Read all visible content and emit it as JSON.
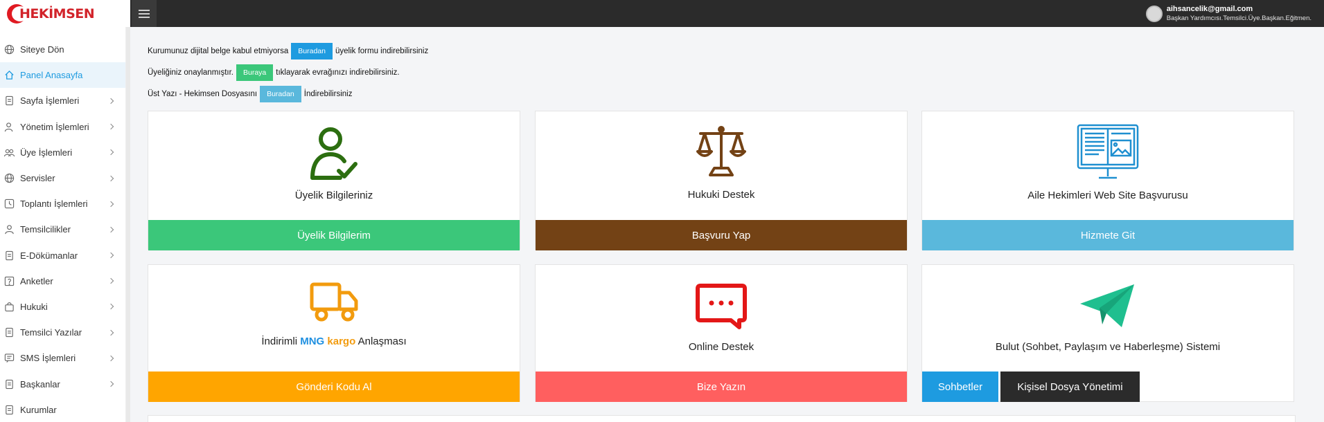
{
  "header": {
    "logo_text": "HEKİMSEN",
    "user_email": "aihsancelik@gmail.com",
    "user_role": "Başkan Yardımcısı.Temsilci.Üye.Başkan.Eğitmen."
  },
  "sidebar": {
    "items": [
      {
        "label": "Siteye Dön",
        "icon": "globe-icon",
        "chevron": false
      },
      {
        "label": "Panel Anasayfa",
        "icon": "home-icon",
        "chevron": false,
        "active": true
      },
      {
        "label": "Sayfa İşlemleri",
        "icon": "document-icon",
        "chevron": true
      },
      {
        "label": "Yönetim İşlemleri",
        "icon": "user-gear-icon",
        "chevron": true
      },
      {
        "label": "Üye İşlemleri",
        "icon": "users-icon",
        "chevron": true
      },
      {
        "label": "Servisler",
        "icon": "globe-icon",
        "chevron": true
      },
      {
        "label": "Toplantı İşlemleri",
        "icon": "clock-icon",
        "chevron": true
      },
      {
        "label": "Temsilcilikler",
        "icon": "user-icon",
        "chevron": true
      },
      {
        "label": "E-Dökümanlar",
        "icon": "document-icon",
        "chevron": true
      },
      {
        "label": "Anketler",
        "icon": "question-icon",
        "chevron": true
      },
      {
        "label": "Hukuki",
        "icon": "bag-icon",
        "chevron": true
      },
      {
        "label": "Temsilci Yazılar",
        "icon": "document-icon",
        "chevron": true
      },
      {
        "label": "SMS İşlemleri",
        "icon": "message-icon",
        "chevron": true
      },
      {
        "label": "Başkanlar",
        "icon": "document-icon",
        "chevron": true
      },
      {
        "label": "Kurumlar",
        "icon": "document-icon",
        "chevron": false
      }
    ]
  },
  "notices": [
    {
      "before": "Kurumunuz dijital belge kabul etmiyorsa",
      "button": "Buradan",
      "after": "üyelik formu indirebilirsiniz",
      "color": "#1e9be0"
    },
    {
      "before": "Üyeliğiniz onaylanmıştır.",
      "button": "Buraya",
      "after": "tıklayarak evrağınızı indirebilirsiniz.",
      "color": "#3bc77a"
    },
    {
      "before": "Üst Yazı - Hekimsen Dosyasını",
      "button": "Buradan",
      "after": "İndirebilirsiniz",
      "color": "#5ab8dc"
    }
  ],
  "cards": {
    "membership": {
      "title": "Üyelik Bilgileriniz",
      "button": "Üyelik Bilgilerim",
      "color": "#3bc77a",
      "icon": "user-check-icon"
    },
    "legal": {
      "title": "Hukuki Destek",
      "button": "Başvuru Yap",
      "color": "#734215",
      "icon": "scales-icon"
    },
    "website": {
      "title": "Aile Hekimleri Web Site Başvurusu",
      "button": "Hizmete Git",
      "color": "#5ab8dc",
      "icon": "monitor-icon"
    },
    "cargo": {
      "title_prefix": "İndirimli",
      "title_mng": "MNG",
      "title_kargo": "kargo",
      "title_suffix": "Anlaşması",
      "button": "Gönderi Kodu Al",
      "color": "#ffa500",
      "icon": "truck-icon"
    },
    "support": {
      "title": "Online Destek",
      "button": "Bize Yazın",
      "color": "#ff5f5f",
      "icon": "chat-icon"
    },
    "cloud": {
      "title": "Bulut (Sohbet, Paylaşım ve Haberleşme) Sistemi",
      "button1": "Sohbetler",
      "button2": "Kişisel Dosya Yönetimi",
      "color1": "#1e9be0",
      "color2": "#2b2b2b",
      "icon": "paper-plane-icon"
    }
  }
}
